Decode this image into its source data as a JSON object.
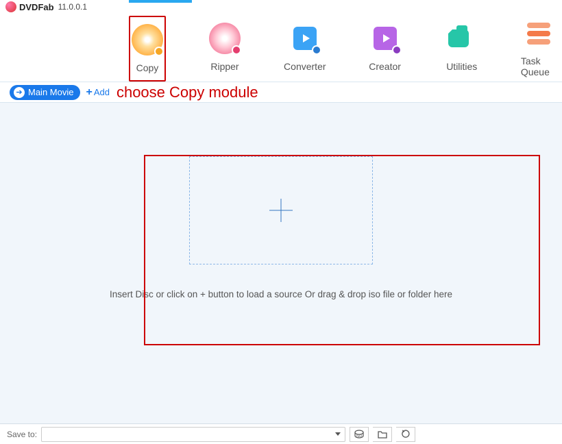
{
  "app": {
    "brand": "DVDFab",
    "version": "11.0.0.1"
  },
  "modules": [
    {
      "id": "copy",
      "label": "Copy",
      "icon": "copy-disc-icon",
      "active": true
    },
    {
      "id": "ripper",
      "label": "Ripper",
      "icon": "ripper-disc-icon",
      "active": false
    },
    {
      "id": "converter",
      "label": "Converter",
      "icon": "converter-icon",
      "active": false
    },
    {
      "id": "creator",
      "label": "Creator",
      "icon": "creator-icon",
      "active": false
    },
    {
      "id": "utilities",
      "label": "Utilities",
      "icon": "utilities-icon",
      "active": false
    },
    {
      "id": "taskqueue",
      "label": "Task Queue",
      "icon": "taskqueue-icon",
      "active": false
    }
  ],
  "toolbar": {
    "mode_label": "Main Movie",
    "add_label": "Add"
  },
  "annotation": {
    "text": "choose Copy module"
  },
  "workspace": {
    "hint": "Insert Disc or click on + button to load a source Or drag & drop iso file or folder here"
  },
  "bottombar": {
    "save_label": "Save to:",
    "save_value": "",
    "buttons": [
      "iso-icon",
      "folder-icon",
      "refresh-icon"
    ]
  }
}
